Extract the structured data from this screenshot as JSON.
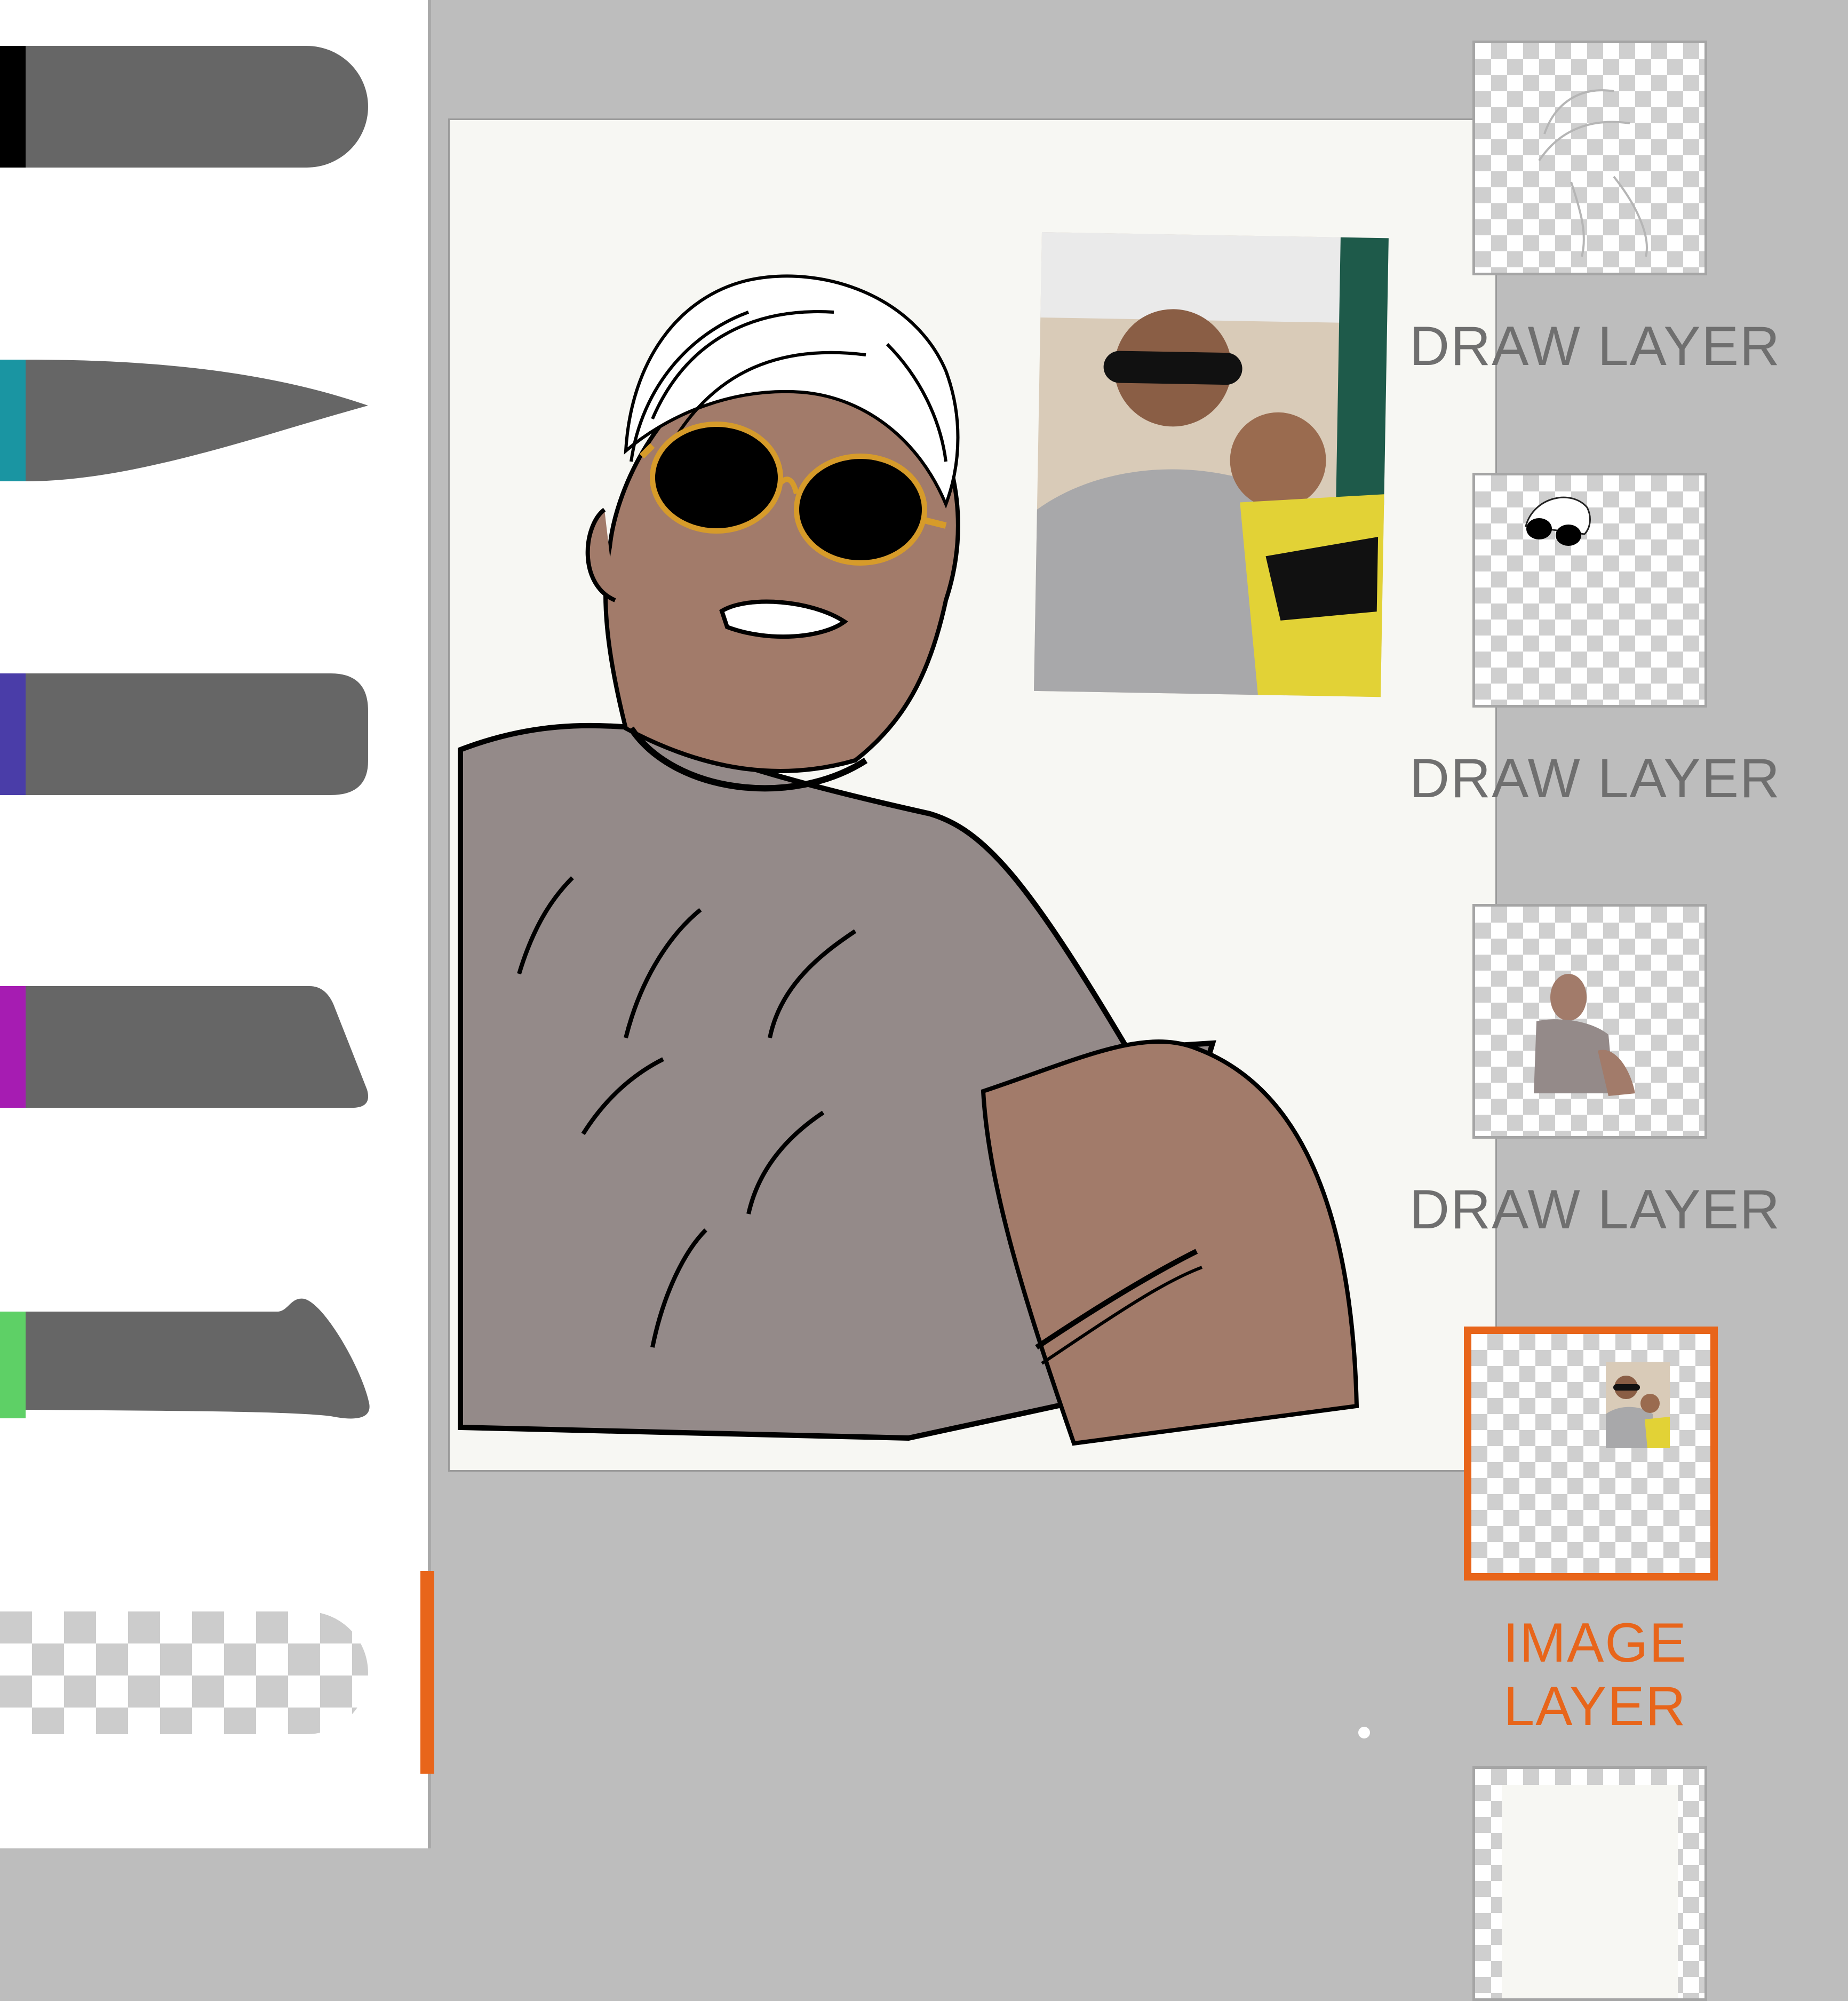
{
  "colors": {
    "accent": "#e8651a",
    "canvas_background": "#f7f7f3",
    "workspace_background": "#bdbdbd",
    "brush_body": "#666666"
  },
  "brushes": [
    {
      "name": "round-brush",
      "color": "#000000"
    },
    {
      "name": "tapered-brush",
      "color": "#1a95a2"
    },
    {
      "name": "flat-brush",
      "color": "#4a3da8"
    },
    {
      "name": "chisel-brush",
      "color": "#a61cb2"
    },
    {
      "name": "blob-brush",
      "color": "#5ed066"
    },
    {
      "name": "eraser-brush",
      "color": "transparent",
      "selected": true
    }
  ],
  "layers": [
    {
      "label": "DRAW LAYER",
      "selected": false,
      "content": "hair-outline"
    },
    {
      "label": "DRAW LAYER",
      "selected": false,
      "content": "sunglasses-and-hair"
    },
    {
      "label": "DRAW LAYER",
      "selected": false,
      "content": "skin-and-shirt-fill"
    },
    {
      "label": "IMAGE LAYER",
      "selected": true,
      "content": "reference-photo"
    },
    {
      "label": "",
      "selected": false,
      "content": "background"
    }
  ]
}
